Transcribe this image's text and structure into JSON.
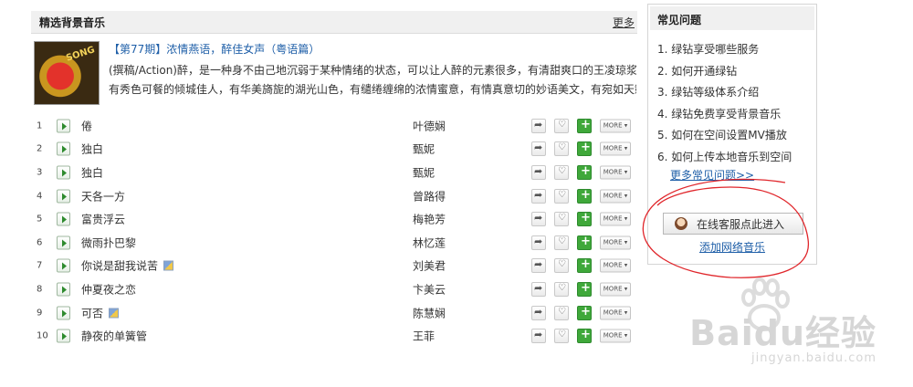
{
  "left": {
    "title": "精选背景音乐",
    "more": "更多",
    "feature": {
      "cover_text": "SONG",
      "title": "【第77期】浓情燕语，醉佳女声（粤语篇）",
      "desc_line1": "(撰稿/Action)醉，是一种身不由己地沉弱于某种情绪的状态，可以让人醉的元素很多，有清甜爽口的王凌琼浆，",
      "desc_line2": "有秀色可餐的倾城佳人，有华美旖旎的湖光山色，有缱绻缠绵的浓情蜜意，有情真意切的妙语美文，有宛如天籁"
    },
    "more_label": "MORE",
    "songs": [
      {
        "num": "1",
        "name": "倦",
        "artist": "叶德娴",
        "note": false
      },
      {
        "num": "2",
        "name": "独白",
        "artist": "甄妮",
        "note": false
      },
      {
        "num": "3",
        "name": "独白",
        "artist": "甄妮",
        "note": false
      },
      {
        "num": "4",
        "name": "天各一方",
        "artist": "曾路得",
        "note": false
      },
      {
        "num": "5",
        "name": "富贵浮云",
        "artist": "梅艳芳",
        "note": false
      },
      {
        "num": "6",
        "name": "微雨扑巴黎",
        "artist": "林忆莲",
        "note": false
      },
      {
        "num": "7",
        "name": "你说是甜我说苦",
        "artist": "刘美君",
        "note": true
      },
      {
        "num": "8",
        "name": "仲夏夜之恋",
        "artist": "卞美云",
        "note": false
      },
      {
        "num": "9",
        "name": "可否",
        "artist": "陈慧娴",
        "note": true
      },
      {
        "num": "10",
        "name": "静夜的单簧管",
        "artist": "王菲",
        "note": false
      }
    ]
  },
  "right": {
    "title": "常见问题",
    "faq": [
      "1. 绿钻享受哪些服务",
      "2. 如何开通绿钻",
      "3. 绿钻等级体系介绍",
      "4. 绿钻免费享受背景音乐",
      "5. 如何在空间设置MV播放",
      "6. 如何上传本地音乐到空间"
    ],
    "faq_more": "更多常见问题>>",
    "service_button": "在线客服点此进入",
    "add_music": "添加网络音乐"
  },
  "watermark": {
    "main": "Baidu经验",
    "url": "jingyan.baidu.com"
  },
  "colors": {
    "link": "#1f5fa8",
    "header_bg": "#f0f0f0",
    "add_green": "#3fa83a",
    "annotation_red": "#e0262b"
  }
}
